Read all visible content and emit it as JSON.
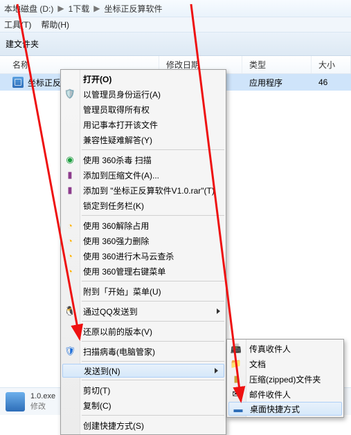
{
  "breadcrumb": {
    "sep": "▶",
    "drive": "本地磁盘 (D:)",
    "folder1": "1下载",
    "folder2": "坐标正反算软件"
  },
  "menubar": {
    "tools": "工具(T)",
    "help": "帮助(H)"
  },
  "toolbar": {
    "newfolder": "建文件夹"
  },
  "columns": {
    "name": "名称",
    "date": "修改日期",
    "type": "类型",
    "size": "大小"
  },
  "file": {
    "name": "坐标正反算",
    "type_text": "应用程序",
    "size_text": "46"
  },
  "status": {
    "filename": "1.0.exe",
    "modlabel": "修改"
  },
  "ctx": {
    "open": "打开(O)",
    "runas": "以管理员身份运行(A)",
    "adminperm": "管理员取得所有权",
    "notepad": "用记事本打开该文件",
    "compat": "兼容性疑难解答(Y)",
    "scan360": "使用 360杀毒 扫描",
    "addarc": "添加到压缩文件(A)...",
    "addrar": "添加到 \"坐标正反算软件V1.0.rar\"(T)",
    "pin": "锁定到任务栏(K)",
    "unlock360": "使用 360解除占用",
    "force360": "使用 360强力删除",
    "trojan360": "使用 360进行木马云查杀",
    "rmenu360": "使用 360管理右键菜单",
    "attachstart": "附到「开始」菜单(U)",
    "qqsend": "通过QQ发送到",
    "restore": "还原以前的版本(V)",
    "scanvir": "扫描病毒(电脑管家)",
    "sendto": "发送到(N)",
    "cut": "剪切(T)",
    "copy": "复制(C)",
    "shortcut": "创建快捷方式(S)"
  },
  "sub": {
    "fax": "传真收件人",
    "docs": "文档",
    "zip": "压缩(zipped)文件夹",
    "mail": "邮件收件人",
    "desktop": "桌面快捷方式"
  }
}
